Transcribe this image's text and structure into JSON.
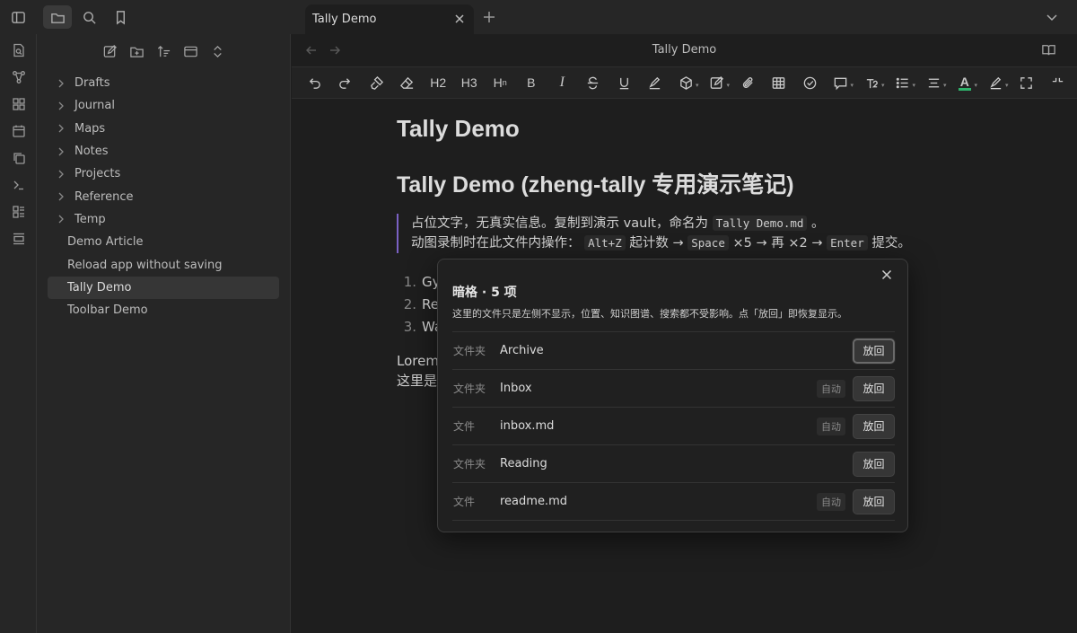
{
  "app": {
    "tab_title": "Tally Demo",
    "view_title": "Tally Demo"
  },
  "explorer": {
    "folders": [
      "Drafts",
      "Journal",
      "Maps",
      "Notes",
      "Projects",
      "Reference",
      "Temp"
    ],
    "files": [
      "Demo Article",
      "Reload app without saving",
      "Tally Demo",
      "Toolbar Demo"
    ],
    "active_file": "Tally Demo"
  },
  "toolbar": {
    "h2": "H2",
    "h3": "H3",
    "hn": "H",
    "hn_sub": "n",
    "bold": "B",
    "italic": "I",
    "font_color_letter": "A"
  },
  "note": {
    "h1": "Tally Demo",
    "h2": "Tally Demo (zheng-tally 专用演示笔记)",
    "quote_line1_text": "占位文字，无真实信息。复制到演示 vault，命名为",
    "quote_line1_code": "Tally Demo.md",
    "quote_line1_end": "。",
    "quote_line2_a": "动图录制时在此文件内操作：",
    "quote_line2_code1": "Alt+Z",
    "quote_line2_b": "起计数 →",
    "quote_line2_code2": "Space",
    "quote_line2_c": "×5 → 再 ×2 →",
    "quote_line2_code3": "Enter",
    "quote_line2_d": "提交。",
    "list": [
      {
        "num": "1.",
        "text": "Gy"
      },
      {
        "num": "2.",
        "text": "Re"
      },
      {
        "num": "3.",
        "text": "Wa"
      }
    ],
    "para_line1": "Lorem",
    "para_line2": "这里是"
  },
  "modal": {
    "title": "暗格 · 5 项",
    "description": "这里的文件只是左侧不显示，位置、知识图谱、搜索都不受影响。点「放回」即恢复显示。",
    "items": [
      {
        "kind": "文件夹",
        "name": "Archive",
        "badge": "",
        "button": "放回"
      },
      {
        "kind": "文件夹",
        "name": "Inbox",
        "badge": "自动",
        "button": "放回"
      },
      {
        "kind": "文件",
        "name": "inbox.md",
        "badge": "自动",
        "button": "放回"
      },
      {
        "kind": "文件夹",
        "name": "Reading",
        "badge": "",
        "button": "放回"
      },
      {
        "kind": "文件",
        "name": "readme.md",
        "badge": "自动",
        "button": "放回"
      }
    ]
  },
  "colors": {
    "accent_purple": "#7b61c4",
    "font_color_underline": "#2fb26b"
  }
}
